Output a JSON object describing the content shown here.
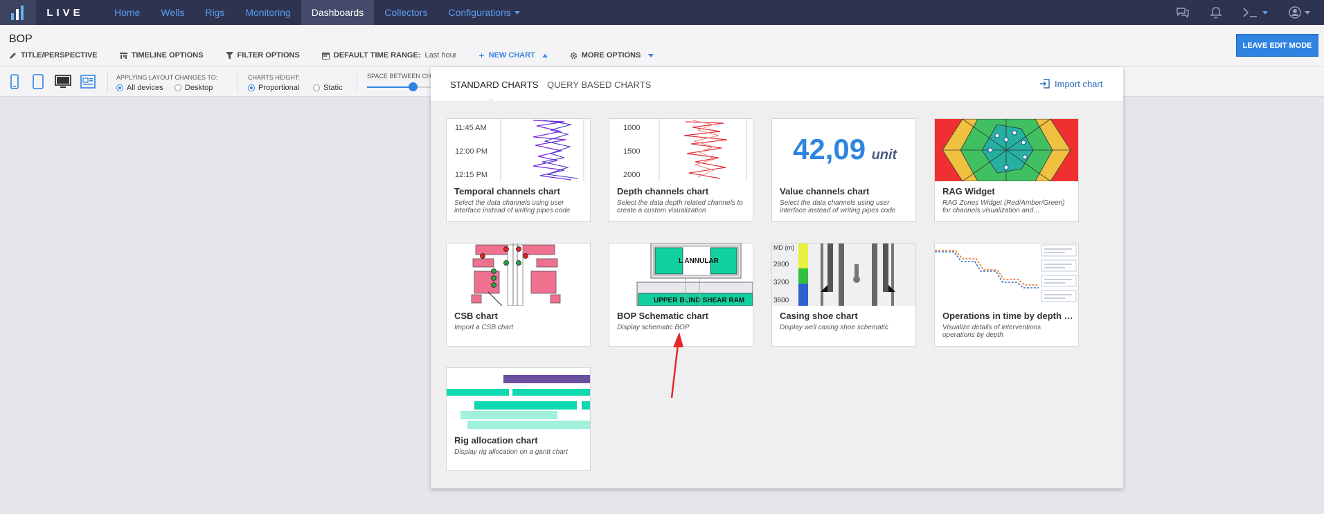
{
  "nav": {
    "brand": "LIVE",
    "links": [
      {
        "label": "Home"
      },
      {
        "label": "Wells"
      },
      {
        "label": "Rigs"
      },
      {
        "label": "Monitoring"
      },
      {
        "label": "Dashboards",
        "active": true
      },
      {
        "label": "Collectors"
      },
      {
        "label": "Configurations",
        "dropdown": true
      }
    ],
    "icons": [
      "chat-icon",
      "bell-icon",
      "terminal-icon",
      "user-icon"
    ]
  },
  "page": {
    "title": "BOP",
    "toolbar": {
      "title_perspective": "TITLE/PERSPECTIVE",
      "timeline_options": "TIMELINE OPTIONS",
      "filter_options": "FILTER OPTIONS",
      "default_time_range_label": "DEFAULT TIME RANGE:",
      "default_time_range_value": "Last hour",
      "new_chart": "NEW CHART",
      "more_options": "MORE OPTIONS"
    },
    "leave_edit_mode": "LEAVE EDIT MODE"
  },
  "layout_bar": {
    "applying_label": "APPLYING LAYOUT CHANGES TO:",
    "applying_options": [
      "All devices",
      "Desktop"
    ],
    "applying_selected": "All devices",
    "charts_height_label": "CHARTS HEIGHT:",
    "charts_height_options": [
      "Proportional",
      "Static"
    ],
    "charts_height_selected": "Proportional",
    "space_between_label": "SPACE BETWEEN CHAR"
  },
  "panel": {
    "tabs": [
      "STANDARD CHARTS",
      "QUERY BASED CHARTS"
    ],
    "active_tab": "STANDARD CHARTS",
    "import_chart": "Import chart",
    "cards": [
      {
        "id": "temporal",
        "title": "Temporal channels chart",
        "description": "Select the data channels using user interface instead of writing pipes code",
        "ticks": [
          "11:45 AM",
          "12:00 PM",
          "12:15 PM"
        ]
      },
      {
        "id": "depth",
        "title": "Depth channels chart",
        "description": "Select the data depth related channels to create a custom visualization",
        "ticks": [
          "1000",
          "1500",
          "2000"
        ]
      },
      {
        "id": "value",
        "title": "Value channels chart",
        "description": "Select the data channels using user interface instead of writing pipes code",
        "value": "42,09",
        "unit": "unit"
      },
      {
        "id": "rag",
        "title": "RAG Widget",
        "description": "RAG Zones Widget (Red/Amber/Green) for channels visualization and…"
      },
      {
        "id": "csb",
        "title": "CSB chart",
        "description": "Import a CSB chart"
      },
      {
        "id": "bop",
        "title": "BOP Schematic chart",
        "description": "Display schematic BOP",
        "labels": [
          "L ANNULAR",
          "UPPER BLIND SHEAR RAM"
        ]
      },
      {
        "id": "casing",
        "title": "Casing shoe chart",
        "description": "Display well casing shoe schematic",
        "labels": [
          "MD (m)",
          "2800",
          "3200",
          "3600"
        ]
      },
      {
        "id": "operations",
        "title": "Operations in time by depth …",
        "description": "Visualize details of interventions operations by depth"
      },
      {
        "id": "rig",
        "title": "Rig allocation chart",
        "description": "Display rig allocation on a gantt chart"
      }
    ]
  },
  "colors": {
    "nav_bg": "#2e3350",
    "accent": "#2f84e1",
    "link": "#5b9cf0",
    "value_blue": "#2e86de",
    "annotation_arrow": "#e8262b"
  }
}
